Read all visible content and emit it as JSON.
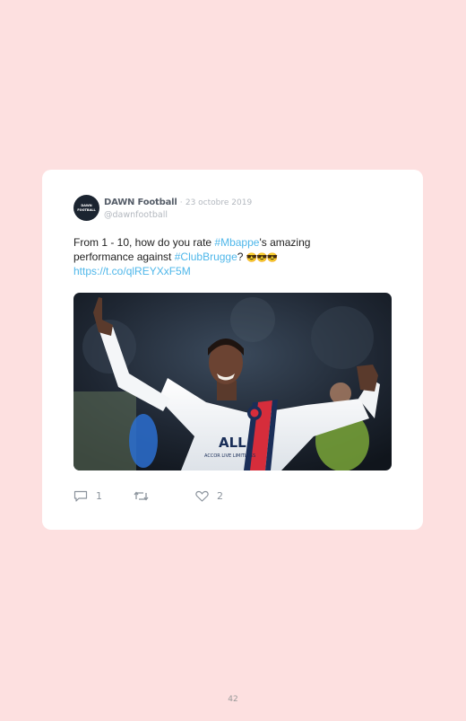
{
  "tweet": {
    "avatar_text_1": "DAWN",
    "avatar_text_2": "FOOTBALL",
    "author_name": "DAWN Football",
    "separator": "·",
    "date": "23 octobre 2019",
    "handle": "@dawnfootball",
    "text_part1": "From 1 - 10, how do you rate ",
    "hashtag_mbappe": "#Mbappe",
    "text_part2": "'s amazing performance against ",
    "hashtag_clubbrugge": "#ClubBrugge",
    "text_part3": "? ",
    "emojis": "😎😎😎",
    "link": "https://t.co/qlREYXxF5M",
    "replies": "1",
    "likes": "2",
    "photo_sponsor_text": "ALL",
    "photo_sponsor_sub": "ACCOR LIVE LIMITLESS"
  },
  "page_number": "42",
  "colors": {
    "background": "#fde0e0",
    "card": "#ffffff",
    "link": "#4fb7ea"
  },
  "icons": [
    "comment-icon",
    "retweet-icon",
    "heart-icon"
  ]
}
